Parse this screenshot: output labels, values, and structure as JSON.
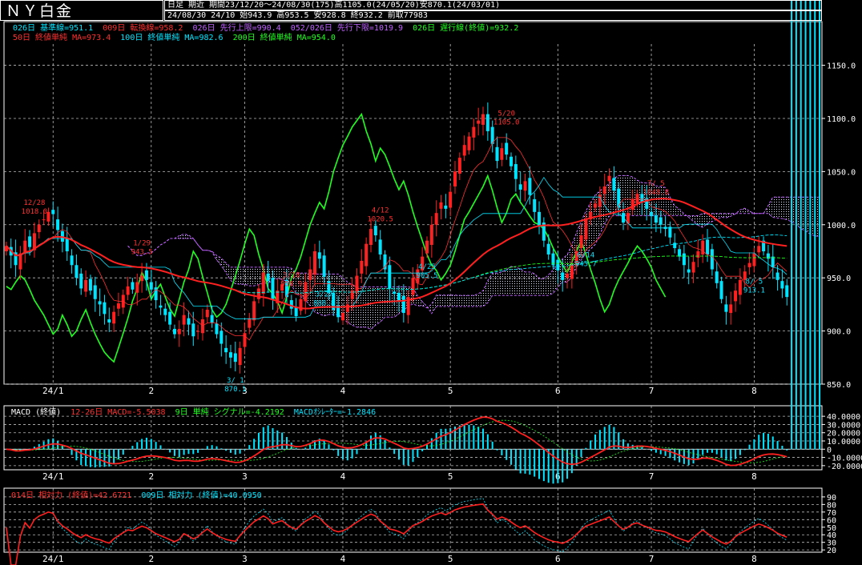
{
  "title": "ＮＹ白金",
  "header": {
    "line1": "日足 期近 期間23/12/20～24/08/30(175)高1105.0(24/05/20)安870.1(24/03/01)",
    "line2": "24/08/30 24/10 始943.9 高953.5 安928.8 終932.2 前取77983"
  },
  "indicators": {
    "row1": [
      {
        "text": "026日 基準線=951.1",
        "color": "#00e5ff"
      },
      {
        "text": "009日 転換線=958.2",
        "color": "#ff3030"
      },
      {
        "text": "026日 先行上限=990.4",
        "color": "#c060ff"
      },
      {
        "text": "052/026日 先行下限=1019.9",
        "color": "#c060ff"
      },
      {
        "text": "026日 遅行線(終値)=932.2",
        "color": "#20ff20"
      }
    ],
    "row2": [
      {
        "text": "50日 終値単純 MA=973.4",
        "color": "#ff3030"
      },
      {
        "text": "100日 終値単純 MA=982.6",
        "color": "#00e5ff"
      },
      {
        "text": "200日 終値単純 MA=954.0",
        "color": "#20ff20"
      }
    ]
  },
  "macd_header": [
    {
      "text": "MACD (終値)",
      "color": "#ffffff"
    },
    {
      "text": "12-26日 MACD=-5.5038",
      "color": "#ff3030"
    },
    {
      "text": "9日 単純 シグナル=-4.2192",
      "color": "#20ff20"
    },
    {
      "text": "MACDｵｼﾚｰﾀｰ=-1.2846",
      "color": "#00e5ff"
    }
  ],
  "rsi_header": [
    {
      "text": "014日 相対力 (終値)=42.6721",
      "color": "#ff3030"
    },
    {
      "text": "009日 相対力 (終値)=40.0950",
      "color": "#00e5ff"
    }
  ],
  "chart_data": {
    "type": "candlestick",
    "x_tick_labels": [
      "24/1",
      "2",
      "3",
      "4",
      "5",
      "6",
      "7",
      "8"
    ],
    "x_tick_index": [
      10,
      31,
      51,
      72,
      95,
      118,
      138,
      160
    ],
    "n_bars": 175,
    "price": {
      "ylim": [
        850,
        1170
      ],
      "y_ticks": [
        850,
        900,
        950,
        1000,
        1050,
        1100,
        1150
      ],
      "y_tick_labels": [
        "850.0",
        "900.0",
        "950.0",
        "1000.0",
        "1050.0",
        "1100.0",
        "1150.0"
      ],
      "closes": [
        980,
        971,
        962,
        973,
        985,
        979,
        992,
        1000,
        1005,
        1012,
        1010,
        995,
        984,
        975,
        962,
        950,
        940,
        948,
        938,
        930,
        925,
        916,
        908,
        918,
        926,
        934,
        942,
        939,
        946,
        952,
        948,
        939,
        929,
        922,
        915,
        906,
        897,
        902,
        915,
        906,
        895,
        900,
        911,
        920,
        908,
        897,
        888,
        880,
        875,
        871,
        884,
        898,
        912,
        928,
        940,
        955,
        947,
        930,
        938,
        944,
        932,
        921,
        914,
        930,
        946,
        958,
        975,
        968,
        951,
        936,
        920,
        913,
        917,
        925,
        938,
        952,
        966,
        982,
        996,
        990,
        972,
        958,
        940,
        935,
        928,
        917,
        932,
        950,
        958,
        970,
        985,
        1000,
        1011,
        1021,
        1015,
        1031,
        1050,
        1063,
        1075,
        1083,
        1092,
        1098,
        1104,
        1088,
        1076,
        1060,
        1072,
        1066,
        1055,
        1043,
        1033,
        1041,
        1028,
        1012,
        998,
        985,
        972,
        962,
        957,
        948,
        954,
        962,
        975,
        990,
        1005,
        1012,
        1020,
        1028,
        1036,
        1046,
        1032,
        1016,
        1002,
        1011,
        1024,
        1029,
        1021,
        1015,
        1008,
        1002,
        1000,
        996,
        988,
        978,
        970,
        962,
        955,
        965,
        975,
        985,
        972,
        958,
        945,
        930,
        918,
        925,
        938,
        948,
        956,
        964,
        973,
        980,
        975,
        968,
        960,
        948,
        940,
        932
      ],
      "annotations": [
        {
          "label": "12/28",
          "value": "1018.0",
          "i": 6,
          "where": "above"
        },
        {
          "label": "1/29",
          "value": "943.5",
          "i": 29,
          "where": "above"
        },
        {
          "label": "3/ 1",
          "value": "870.1",
          "i": 49,
          "where": "below"
        },
        {
          "label": "3/18",
          "value": "958.9",
          "i": 61,
          "where": "above"
        },
        {
          "label": "3/27",
          "value": "888.8",
          "i": 68,
          "where": "below"
        },
        {
          "label": "4/12",
          "value": "1020.5",
          "i": 80,
          "where": "above"
        },
        {
          "label": "4/25",
          "value": "905.5",
          "i": 90,
          "where": "below"
        },
        {
          "label": "5/20",
          "value": "1105.0",
          "i": 107,
          "where": "above"
        },
        {
          "label": "6/14",
          "value": "945.7",
          "i": 124,
          "where": "below"
        },
        {
          "label": "7/ 5",
          "value": "1048.8",
          "i": 139,
          "where": "above"
        },
        {
          "label": "8/ 5",
          "value": "913.1",
          "i": 160,
          "where": "below"
        }
      ]
    },
    "macd": {
      "ylim": [
        -25,
        45
      ],
      "y_ticks": [
        40,
        30,
        20,
        10,
        0,
        -10,
        -20
      ],
      "y_tick_labels": [
        "40.0000",
        "30.0000",
        "20.0000",
        "10.0000",
        "0",
        "-10.0000",
        "-20.0000"
      ]
    },
    "rsi": {
      "ylim": [
        17,
        92
      ],
      "y_ticks": [
        90,
        80,
        70,
        60,
        50,
        40,
        30,
        20
      ],
      "y_tick_labels": [
        "90",
        "80",
        "70",
        "60",
        "50",
        "40",
        "30",
        "20"
      ]
    }
  }
}
